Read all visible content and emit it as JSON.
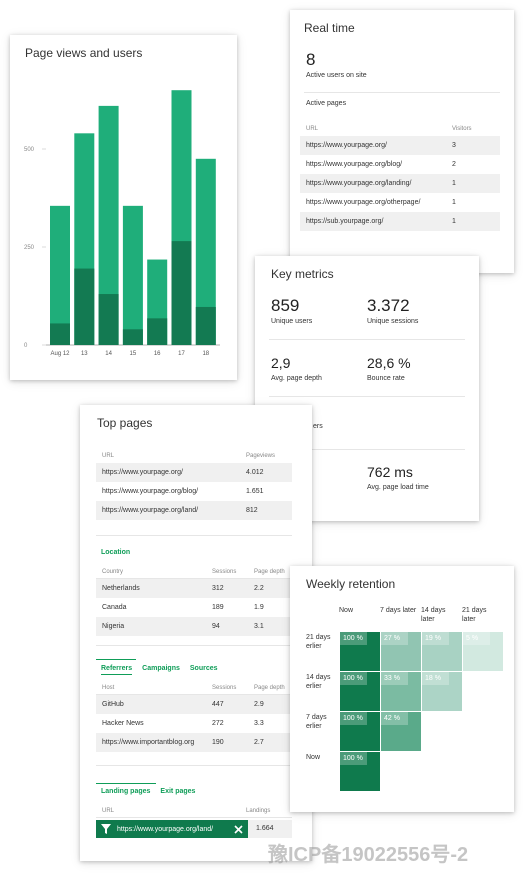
{
  "page_views": {
    "title": "Page views and users",
    "y_ticks": [
      "500",
      "250",
      "0"
    ],
    "x_ticks": [
      "Aug 12",
      "13",
      "14",
      "15",
      "16",
      "17",
      "18"
    ],
    "chart_data": {
      "type": "bar",
      "categories": [
        "Aug 12",
        "13",
        "14",
        "15",
        "16",
        "17",
        "18"
      ],
      "series": [
        {
          "values": [
            355,
            540,
            610,
            355,
            218,
            650,
            475
          ]
        },
        {
          "values": [
            55,
            195,
            130,
            40,
            68,
            265,
            97
          ]
        }
      ],
      "ylim": [
        0,
        500
      ],
      "colors": [
        "#1fae7a",
        "#137a52"
      ]
    }
  },
  "realtime": {
    "title": "Real time",
    "active_users": "8",
    "active_users_label": "Active users on site",
    "active_pages_label": "Active pages",
    "col_url": "URL",
    "col_visitors": "Visitors",
    "rows": [
      {
        "url": "https://www.yourpage.org/",
        "visitors": "3"
      },
      {
        "url": "https://www.yourpage.org/blog/",
        "visitors": "2"
      },
      {
        "url": "https://www.yourpage.org/landing/",
        "visitors": "1"
      },
      {
        "url": "https://www.yourpage.org/otherpage/",
        "visitors": "1"
      },
      {
        "url": "https://sub.yourpage.org/",
        "visitors": "1"
      }
    ]
  },
  "key_metrics": {
    "title": "Key metrics",
    "m1_value": "859",
    "m1_label": "Unique users",
    "m2_value": "3.372",
    "m2_label": "Unique sessions",
    "m3_value": "2,9",
    "m3_label": "Avg. page depth",
    "m4_value": "28,6 %",
    "m4_label": "Bounce rate",
    "m5_label_fragment": "ers",
    "m6_value": "762 ms",
    "m6_label": "Avg. page load time"
  },
  "top_pages": {
    "title": "Top pages",
    "col_url": "URL",
    "col_views": "Pageviews",
    "rows": [
      {
        "url": "https://www.yourpage.org/",
        "views": "4.012"
      },
      {
        "url": "https://www.yourpage.org/blog/",
        "views": "1.651"
      },
      {
        "url": "https://www.yourpage.org/land/",
        "views": "812"
      }
    ],
    "location_label": "Location",
    "loc_cols": {
      "c1": "Country",
      "c2": "Sessions",
      "c3": "Page depth"
    },
    "locations": [
      {
        "name": "Netherlands",
        "sessions": "312",
        "depth": "2.2"
      },
      {
        "name": "Canada",
        "sessions": "189",
        "depth": "1.9"
      },
      {
        "name": "Nigeria",
        "sessions": "94",
        "depth": "3.1"
      }
    ],
    "tabs1": [
      "Referrers",
      "Campaigns",
      "Sources"
    ],
    "ref_cols": {
      "c1": "Host",
      "c2": "Sessions",
      "c3": "Page depth"
    },
    "referrers": [
      {
        "name": "GitHub",
        "sessions": "447",
        "depth": "2.9"
      },
      {
        "name": "Hacker News",
        "sessions": "272",
        "depth": "3.3"
      },
      {
        "name": "https://www.importantblog.org",
        "sessions": "190",
        "depth": "2.7"
      }
    ],
    "tabs2": [
      "Landing pages",
      "Exit pages"
    ],
    "land_cols": {
      "c1": "URL",
      "c2": "Landings"
    },
    "landing_url": "https://www.yourpage.org/land/",
    "landing_value": "1.664"
  },
  "retention": {
    "title": "Weekly retention",
    "cols": [
      "Now",
      "7 days later",
      "14 days later",
      "21 days later"
    ],
    "rows": [
      "21 days erlier",
      "14 days erlier",
      "7 days erlier",
      "Now"
    ],
    "values": [
      [
        "100 %",
        "27 %",
        "19 %",
        "5 %"
      ],
      [
        "100 %",
        "33 %",
        "18 %"
      ],
      [
        "100 %",
        "42 %"
      ],
      [
        "100 %"
      ]
    ],
    "colors": {
      "c100": "#0f7a4d",
      "c42": "#5aaa8a",
      "c33": "#7bbba2",
      "c27": "#91c5b2",
      "c19": "#a8d2c3",
      "c18": "#acd4c6",
      "c5": "#d2e9e0"
    }
  },
  "watermark": "豫ICP备19022556号-2"
}
